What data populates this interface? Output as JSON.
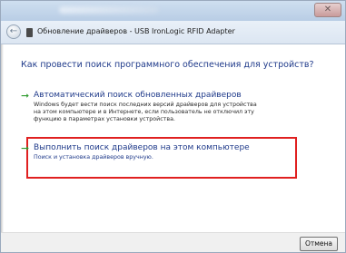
{
  "window": {
    "close_label": "✕"
  },
  "address": {
    "text": "Обновление драйверов - USB IronLogic RFID Adapter"
  },
  "main": {
    "heading": "Как провести поиск программного обеспечения для устройств?",
    "options": [
      {
        "title": "Автоматический поиск обновленных драйверов",
        "description": "Windows будет вести поиск последних версий драйверов для устройства на этом компьютере и в Интернете, если пользователь не отключил эту функцию в параметрах установки устройства."
      },
      {
        "title": "Выполнить поиск драйверов на этом компьютере",
        "description": "Поиск и установка драйверов вручную."
      }
    ]
  },
  "footer": {
    "cancel_label": "Отмена"
  },
  "colors": {
    "link_blue": "#1f3a8a",
    "arrow_green": "#2e9a2e",
    "highlight_red": "#e02020"
  }
}
